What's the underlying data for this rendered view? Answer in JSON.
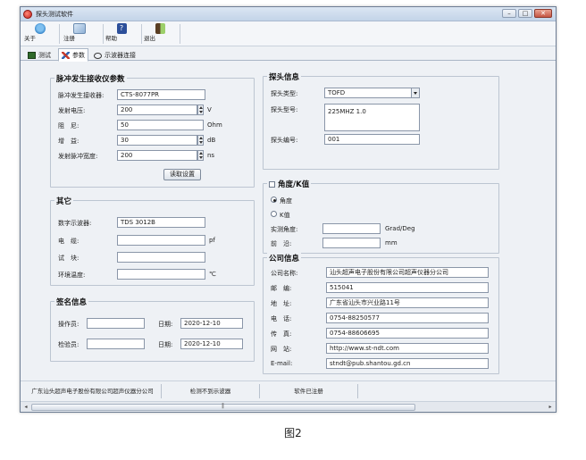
{
  "window": {
    "title": "探头测试软件"
  },
  "toolbar": [
    {
      "label": "关于",
      "icon": "about-icon"
    },
    {
      "label": "注册",
      "icon": "register-icon"
    },
    {
      "label": "帮助",
      "icon": "help-icon"
    },
    {
      "label": "退出",
      "icon": "exit-icon"
    }
  ],
  "tabs": [
    {
      "label": "测试",
      "icon": "test-icon"
    },
    {
      "label": "参数",
      "icon": "params-icon",
      "active": true
    },
    {
      "label": "示波器连接",
      "icon": "scope-link-icon"
    }
  ],
  "pulser": {
    "title": "脉冲发生接收仪参数",
    "rows": [
      {
        "label": "脉冲发生接收器:",
        "value": "CTS-8077PR",
        "unit": ""
      },
      {
        "label": "发射电压:",
        "value": "200",
        "unit": "V"
      },
      {
        "label": "阻　尼:",
        "value": "50",
        "unit": "Ohm"
      },
      {
        "label": "增　益:",
        "value": "30",
        "unit": "dB"
      },
      {
        "label": "发射脉冲宽度:",
        "value": "200",
        "unit": "ns"
      }
    ],
    "read_button": "读取设置"
  },
  "other": {
    "title": "其它",
    "rows": [
      {
        "label": "数字示波器:",
        "value": "TDS 3012B",
        "unit": ""
      },
      {
        "label": "电　缆:",
        "value": "",
        "unit": "pf"
      },
      {
        "label": "试　块:",
        "value": "",
        "unit": ""
      },
      {
        "label": "环境温度:",
        "value": "",
        "unit": "℃"
      }
    ]
  },
  "sign": {
    "title": "签名信息",
    "operator_label": "操作员:",
    "operator_value": "",
    "checker_label": "检验员:",
    "checker_value": "",
    "date_label": "日期:",
    "date1": "2020-12-10",
    "date2": "2020-12-10"
  },
  "probe": {
    "title": "探头信息",
    "type_label": "探头类型:",
    "type_value": "TOFD",
    "model_label": "探头型号:",
    "model_value": "225MHZ 1.0",
    "serial_label": "探头编号:",
    "serial_value": "001"
  },
  "angle": {
    "title": "角度/K值",
    "opt_angle": "角度",
    "opt_k": "K值",
    "measured_label": "实测角度:",
    "measured_unit": "Grad/Deg",
    "front_label": "前　沿:",
    "front_unit": "mm"
  },
  "company": {
    "title": "公司信息",
    "rows": [
      {
        "label": "公司名称:",
        "value": "汕头超声电子股份有限公司超声仪器分公司"
      },
      {
        "label": "邮　编:",
        "value": "515041"
      },
      {
        "label": "地　址:",
        "value": "广东省汕头市兴业路11号"
      },
      {
        "label": "电　话:",
        "value": "0754-88250577"
      },
      {
        "label": "传　真:",
        "value": "0754-88606695"
      },
      {
        "label": "网　站:",
        "value": "http://www.st-ndt.com"
      },
      {
        "label": "E-mail:",
        "value": "stndt@pub.shantou.gd.cn"
      }
    ]
  },
  "status": [
    "广东汕头超声电子股份有限公司超声仪器分公司",
    "检测不到示波器",
    "软件已注册"
  ],
  "caption": "图2"
}
